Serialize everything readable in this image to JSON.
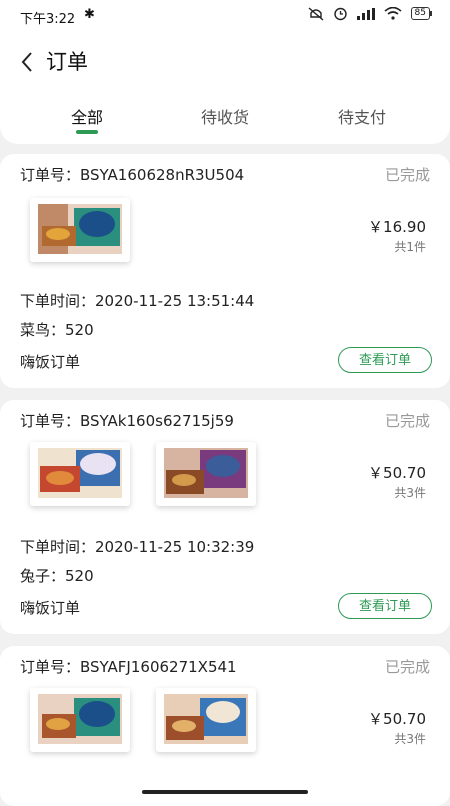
{
  "status_bar": {
    "time": "下午3:22",
    "battery": "85"
  },
  "header": {
    "title": "订单"
  },
  "tabs": [
    {
      "label": "全部"
    },
    {
      "label": "待收货"
    },
    {
      "label": "待支付"
    }
  ],
  "orders": [
    {
      "no_label": "订单号：BSYA160628nR3U504",
      "status": "已完成",
      "price": "￥16.90",
      "count": "共1件",
      "time": "下单时间：2020-11-25 13:51:44",
      "courier": "菜鸟：520",
      "source": "嗨饭订单",
      "button": "查看订单"
    },
    {
      "no_label": "订单号：BSYAk160s62715j59",
      "status": "已完成",
      "price": "￥50.70",
      "count": "共3件",
      "time": "下单时间：2020-11-25 10:32:39",
      "courier": "兔子：520",
      "source": "嗨饭订单",
      "button": "查看订单"
    },
    {
      "no_label": "订单号：BSYAFJ1606271X541",
      "status": "已完成",
      "price": "￥50.70",
      "count": "共3件"
    }
  ],
  "colors": {
    "accent": "#2e9a55",
    "background": "#f1f1f1"
  }
}
